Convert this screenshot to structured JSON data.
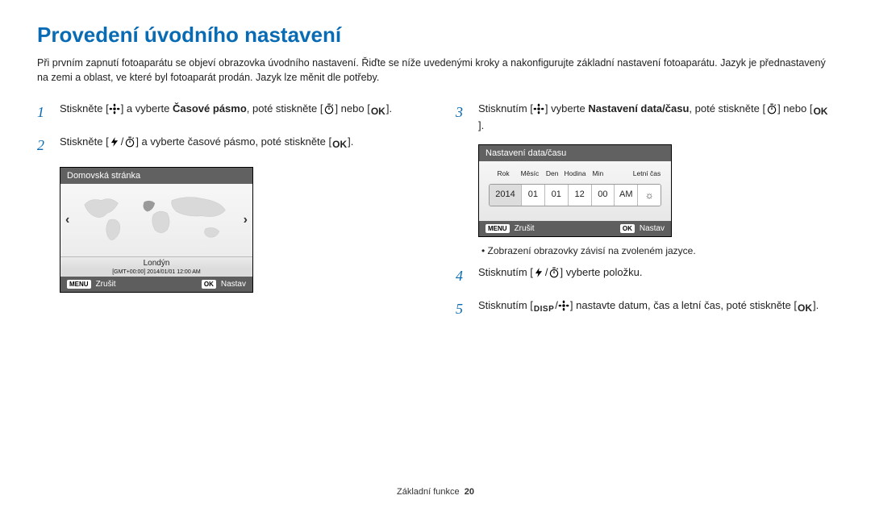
{
  "title": "Provedení úvodního nastavení",
  "intro": "Při prvním zapnutí fotoaparátu se objeví obrazovka úvodního nastavení. Řiďte se níže uvedenými kroky a nakonfigurujte základní nastavení fotoaparátu. Jazyk je přednastavený na zemi a oblast, ve které byl fotoaparát prodán. Jazyk lze měnit dle potřeby.",
  "steps": {
    "s1a": "Stiskněte [",
    "s1b": "] a vyberte ",
    "s1bold": "Časové pásmo",
    "s1c": ", poté stiskněte [",
    "s1d": "] nebo [",
    "s1e": "].",
    "s2a": "Stiskněte [",
    "s2b": "/",
    "s2c": "] a vyberte časové pásmo, poté stiskněte [",
    "s2d": "].",
    "s3a": "Stisknutím [",
    "s3b": "] vyberte ",
    "s3bold": "Nastavení data/času",
    "s3c": ", poté stiskněte [",
    "s3d": "] nebo [",
    "s3e": "].",
    "s4a": "Stisknutím [",
    "s4b": "/",
    "s4c": "] vyberte položku.",
    "s5a": "Stisknutím [",
    "s5b": "/",
    "s5c": "] nastavte datum, čas a letní čas, poté stiskněte [",
    "s5d": "]."
  },
  "screen1": {
    "title": "Domovská stránka",
    "city": "Londýn",
    "gmt": "[GMT+00:00] 2014/01/01 12:00 AM",
    "menu": "MENU",
    "cancel": "Zrušit",
    "ok": "OK",
    "set": "Nastav"
  },
  "screen2": {
    "title": "Nastavení data/času",
    "hdr": {
      "year": "Rok",
      "month": "Měsíc",
      "day": "Den",
      "hour": "Hodina",
      "min": "Min",
      "dst": "Letní čas"
    },
    "vals": {
      "year": "2014",
      "month": "01",
      "day": "01",
      "hour": "12",
      "min": "00",
      "ampm": "AM"
    },
    "menu": "MENU",
    "cancel": "Zrušit",
    "ok": "OK",
    "set": "Nastav"
  },
  "note": "Zobrazení obrazovky závisí na zvoleném jazyce.",
  "footer_label": "Základní funkce",
  "page": "20",
  "glyph": {
    "ok": "OK",
    "disp": "DISP"
  }
}
